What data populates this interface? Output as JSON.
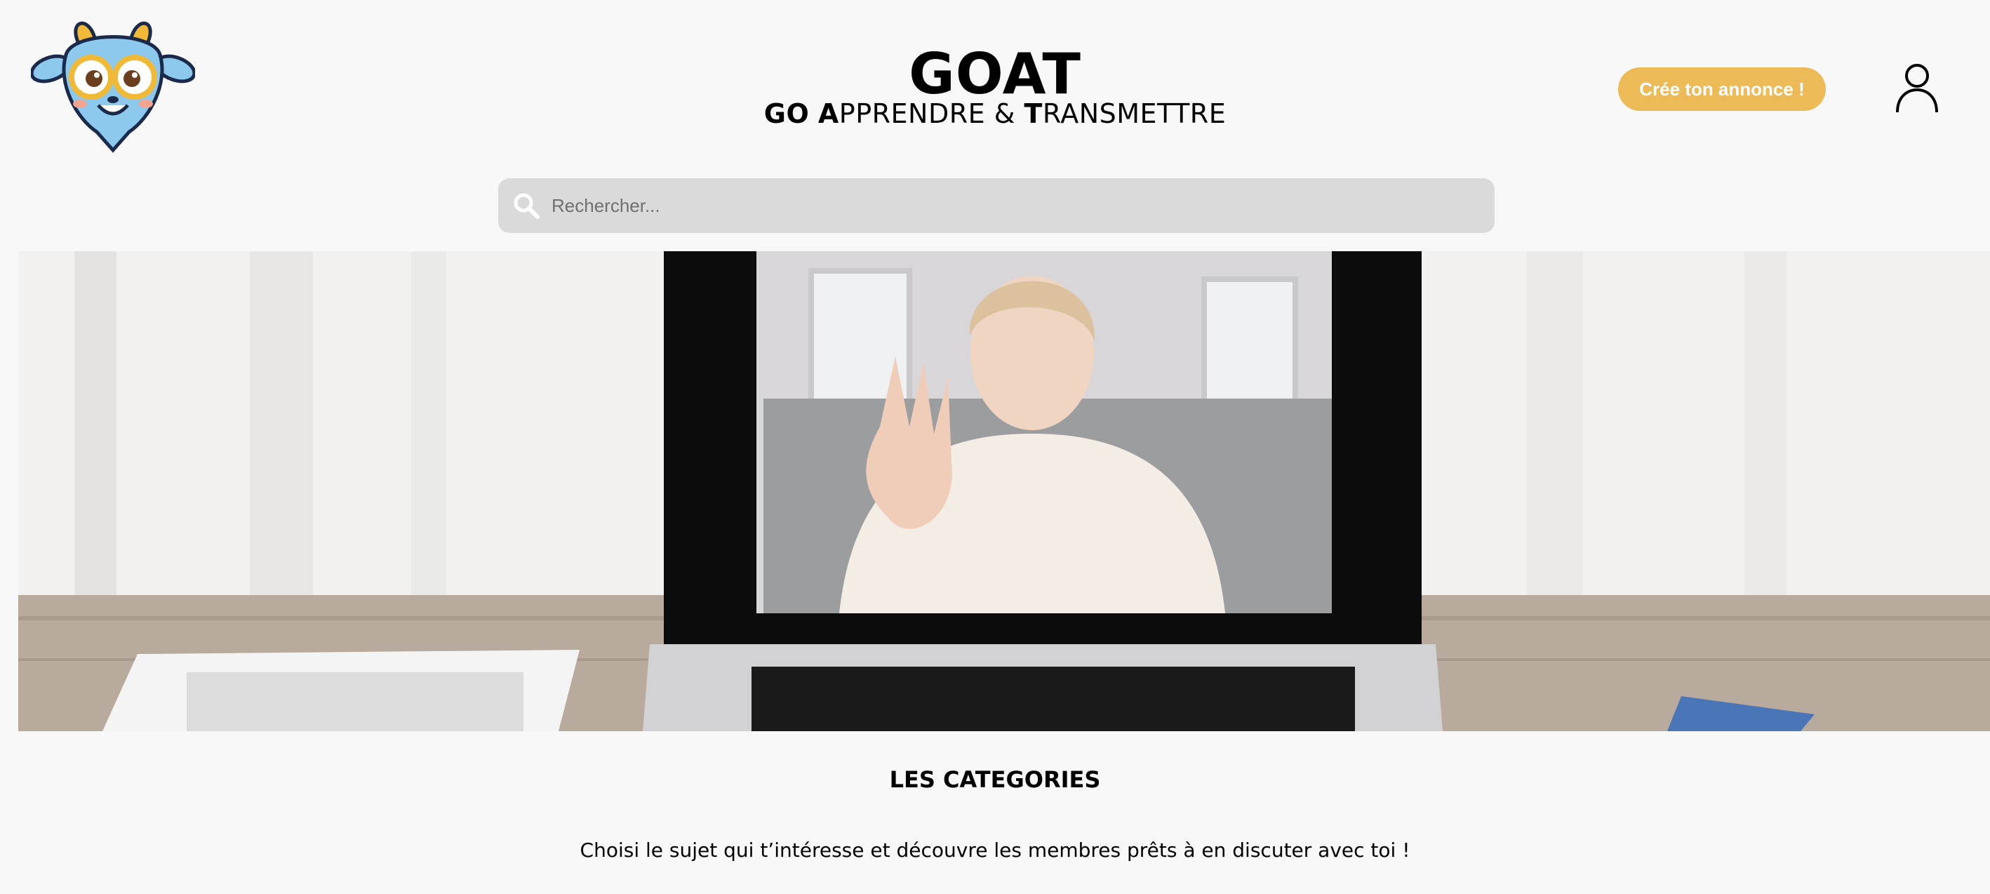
{
  "header": {
    "title": "GOAT",
    "tagline": {
      "go": "GO",
      "a": "A",
      "pprendre": "PPRENDRE & ",
      "t": "T",
      "ransmettre": "RANSMETTRE"
    },
    "cta_label": "Crée ton annonce !",
    "logo_icon": "goat-mascot-icon",
    "user_icon": "user-profile-icon"
  },
  "search": {
    "placeholder": "Rechercher...",
    "value": ""
  },
  "categories": {
    "title": "LES CATEGORIES",
    "description": "Choisi le sujet qui t’intéresse et découvre les membres prêts à en discuter avec toi !"
  },
  "colors": {
    "accent": "#ecba56",
    "background": "#f8f8f8",
    "search_bg": "#dadada"
  }
}
